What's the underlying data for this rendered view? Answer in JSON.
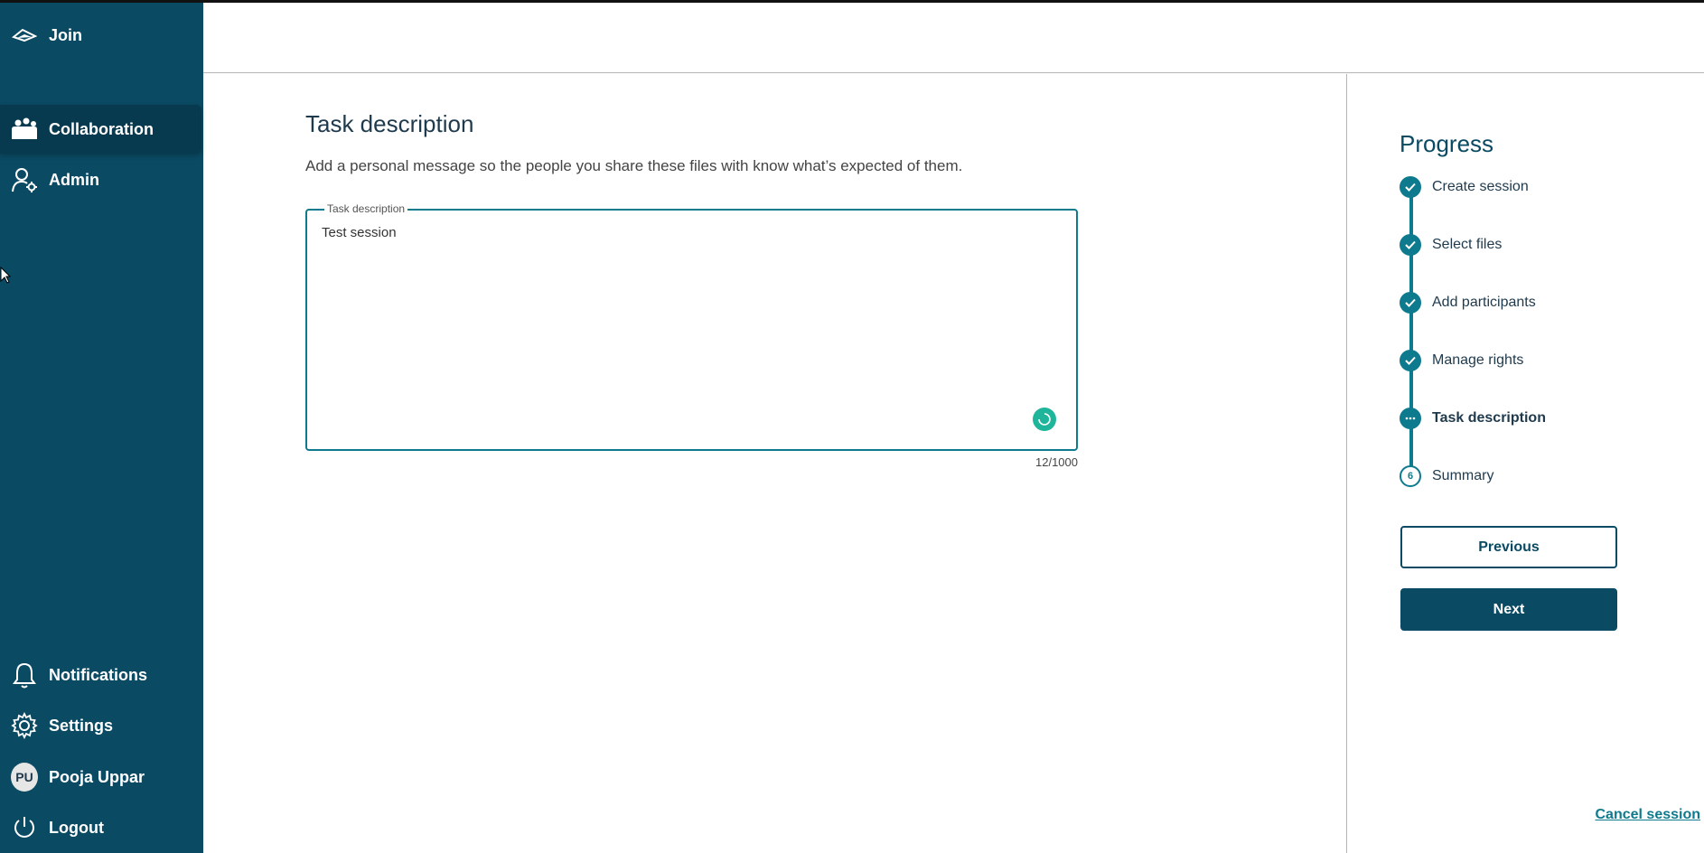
{
  "sidebar": {
    "top_items": [
      {
        "label": "Join",
        "icon": "join-icon"
      },
      {
        "label": "Collaboration",
        "icon": "collaboration-icon",
        "active": true
      },
      {
        "label": "Admin",
        "icon": "admin-user-gear-icon"
      }
    ],
    "bottom_items": [
      {
        "label": "Notifications",
        "icon": "bell-icon"
      },
      {
        "label": "Settings",
        "icon": "gear-icon"
      },
      {
        "label": "Pooja Uppar",
        "icon": "avatar",
        "initials": "PU"
      },
      {
        "label": "Logout",
        "icon": "power-icon"
      }
    ]
  },
  "main": {
    "title": "Task description",
    "subtitle": "Add a personal message so the people you share these files with know what’s expected of them.",
    "field": {
      "legend": "Task description",
      "value": "Test session",
      "counter": "12/1000"
    }
  },
  "progress": {
    "title": "Progress",
    "steps": [
      {
        "label": "Create session",
        "state": "done"
      },
      {
        "label": "Select files",
        "state": "done"
      },
      {
        "label": "Add participants",
        "state": "done"
      },
      {
        "label": "Manage rights",
        "state": "done"
      },
      {
        "label": "Task description",
        "state": "current"
      },
      {
        "label": "Summary",
        "state": "pending",
        "number": "6"
      }
    ],
    "previous_label": "Previous",
    "next_label": "Next",
    "cancel_label": "Cancel session"
  },
  "colors": {
    "sidebar_bg": "#0a4a63",
    "accent": "#0e7a8e",
    "spinner": "#1fb59a"
  }
}
